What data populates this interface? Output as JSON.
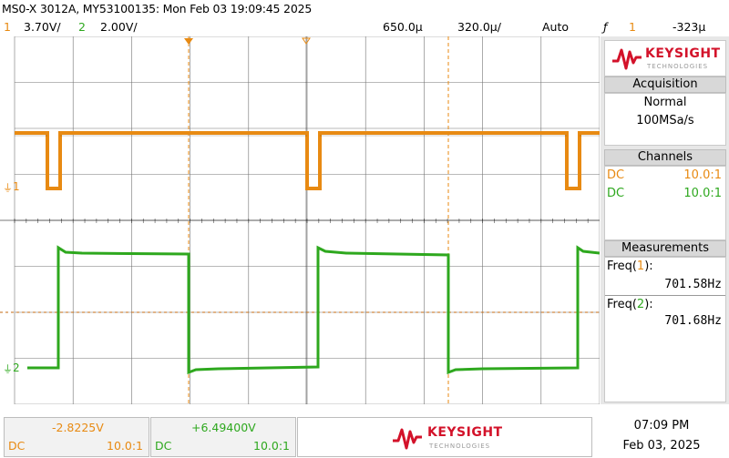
{
  "header": {
    "title": "MS0-X 3012A, MY53100135: Mon Feb 03 19:09:45 2025"
  },
  "status": {
    "ch1_num": "1",
    "ch1_scale": "3.70V/",
    "ch2_num": "2",
    "ch2_scale": "2.00V/",
    "time_pos": "650.0µ",
    "time_scale": "320.0µ/",
    "trigger_mode": "Auto",
    "trigger_symbol": "ƒ",
    "trigger_src": "1",
    "trigger_level": "-323µ"
  },
  "scope": {
    "ch1_marker": "1",
    "ch2_marker": "2",
    "trace_colors": {
      "ch1": "#e88a12",
      "ch2": "#2ea81e",
      "grid": "#000000",
      "bg": "#ffffff"
    }
  },
  "sidebar": {
    "brand": "KEYSIGHT",
    "brand_sub": "TECHNOLOGIES",
    "brand_color": "#d3122a",
    "acquisition": {
      "title": "Acquisition",
      "mode": "Normal",
      "rate": "100MSa/s"
    },
    "channels": {
      "title": "Channels",
      "rows": [
        {
          "coupling": "DC",
          "probe": "10.0:1",
          "color": "#e88a12"
        },
        {
          "coupling": "DC",
          "probe": "10.0:1",
          "color": "#2ea81e"
        }
      ]
    },
    "measurements": {
      "title": "Measurements",
      "items": [
        {
          "label": "Freq(",
          "ch": "1",
          "close": "):",
          "value": "701.58Hz"
        },
        {
          "label": "Freq(",
          "ch": "2",
          "close": "):",
          "value": "701.68Hz"
        }
      ]
    }
  },
  "bottom": {
    "ch1": {
      "offset": "-2.8225V",
      "coupling": "DC",
      "probe": "10.0:1"
    },
    "ch2": {
      "offset": "+6.49400V",
      "coupling": "DC",
      "probe": "10.0:1"
    },
    "brand": "KEYSIGHT",
    "brand_sub": "TECHNOLOGIES",
    "time": "07:09 PM",
    "date": "Feb 03, 2025"
  }
}
